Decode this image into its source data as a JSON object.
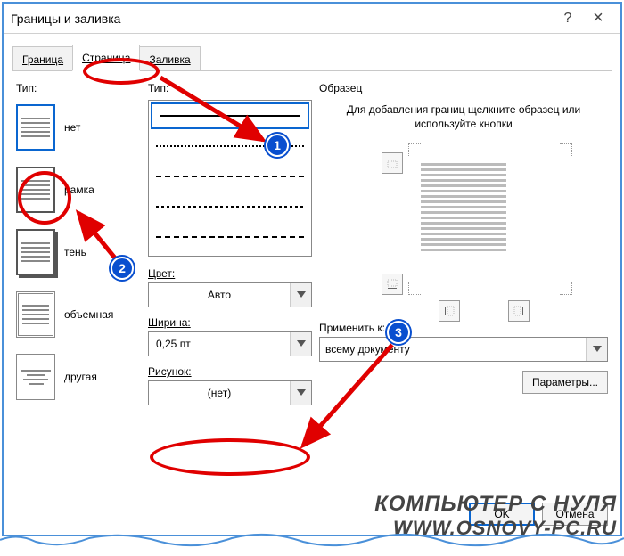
{
  "window": {
    "title": "Границы и заливка",
    "help_symbol": "?",
    "close_symbol": "×"
  },
  "tabs": {
    "items": [
      {
        "label": "Граница",
        "key": "border"
      },
      {
        "label": "Страница",
        "key": "page"
      },
      {
        "label": "Заливка",
        "key": "shading"
      }
    ],
    "active_index": 1
  },
  "left": {
    "section": "Тип:",
    "types": [
      {
        "label": "нет",
        "kind": "none"
      },
      {
        "label": "рамка",
        "kind": "box"
      },
      {
        "label": "тень",
        "kind": "shadow"
      },
      {
        "label": "объемная",
        "kind": "threeD"
      },
      {
        "label": "другая",
        "kind": "custom"
      }
    ],
    "selected_index": 0
  },
  "mid": {
    "line_section": "Тип:",
    "lines": [
      "solid",
      "dotsm",
      "dashl",
      "dashm",
      "dashdot"
    ],
    "selected_line": 0,
    "color_label": "Цвет:",
    "color_value": "Авто",
    "width_label": "Ширина:",
    "width_value": "0,25 пт",
    "art_label": "Рисунок:",
    "art_value": "(нет)"
  },
  "right": {
    "preview_label": "Образец",
    "preview_hint": "Для добавления границ щелкните образец или используйте кнопки",
    "apply_label": "Применить к:",
    "apply_value": "всему документу",
    "params_btn": "Параметры..."
  },
  "footer": {
    "ok": "OK",
    "cancel": "Отмена"
  },
  "annotations": {
    "badge1": "1",
    "badge2": "2",
    "badge3": "3"
  },
  "watermark": {
    "line1": "КОМПЬЮТЕР С НУЛЯ",
    "line2": "WWW.OSNOVY-PC.RU"
  }
}
